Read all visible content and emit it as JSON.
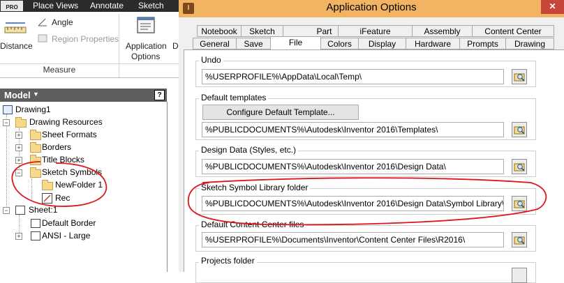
{
  "ribbon": {
    "badge": "PRO",
    "tabs": [
      "Place Views",
      "Annotate",
      "Sketch"
    ],
    "distance_label": "Distance",
    "angle_label": "Angle",
    "region_label": "Region Properties",
    "app_options_line1": "Application",
    "app_options_line2": "Options",
    "cut_label": "D",
    "group_label": "Measure"
  },
  "browser": {
    "title": "Model",
    "help": "?",
    "items": [
      {
        "label": "Drawing1"
      },
      {
        "label": "Drawing Resources"
      },
      {
        "label": "Sheet Formats"
      },
      {
        "label": "Borders"
      },
      {
        "label": "Title Blocks"
      },
      {
        "label": "Sketch Symbols"
      },
      {
        "label": "NewFolder 1"
      },
      {
        "label": "Rec"
      },
      {
        "label": "Sheet:1"
      },
      {
        "label": "Default Border"
      },
      {
        "label": "ANSI - Large"
      }
    ]
  },
  "dialog": {
    "title": "Application Options",
    "close": "✕",
    "icon": "I",
    "tabs_row1": [
      "Notebook",
      "Sketch",
      "Part",
      "iFeature",
      "Assembly",
      "Content Center"
    ],
    "tabs_row2": [
      "General",
      "Save",
      "File",
      "Colors",
      "Display",
      "Hardware",
      "Prompts",
      "Drawing"
    ],
    "active_tab": "File",
    "undo_label": "Undo",
    "undo_path": "%USERPROFILE%\\AppData\\Local\\Temp\\",
    "templates_label": "Default templates",
    "configure_button": "Configure Default Template...",
    "templates_path": "%PUBLICDOCUMENTS%\\Autodesk\\Inventor 2016\\Templates\\",
    "design_data_label": "Design Data (Styles, etc.)",
    "design_data_path": "%PUBLICDOCUMENTS%\\Autodesk\\Inventor 2016\\Design Data\\",
    "symbol_label": "Sketch Symbol Library folder",
    "symbol_path": "%PUBLICDOCUMENTS%\\Autodesk\\Inventor 2016\\Design Data\\Symbol Library\\",
    "content_center_label": "Default Content Center files",
    "content_center_path": "%USERPROFILE%\\Documents\\Inventor\\Content Center Files\\R2016\\",
    "projects_label": "Projects folder"
  },
  "colors": {
    "annotation": "#e0141c",
    "titlebar": "#f2b463",
    "ribbon_dark": "#2b2b2b"
  }
}
